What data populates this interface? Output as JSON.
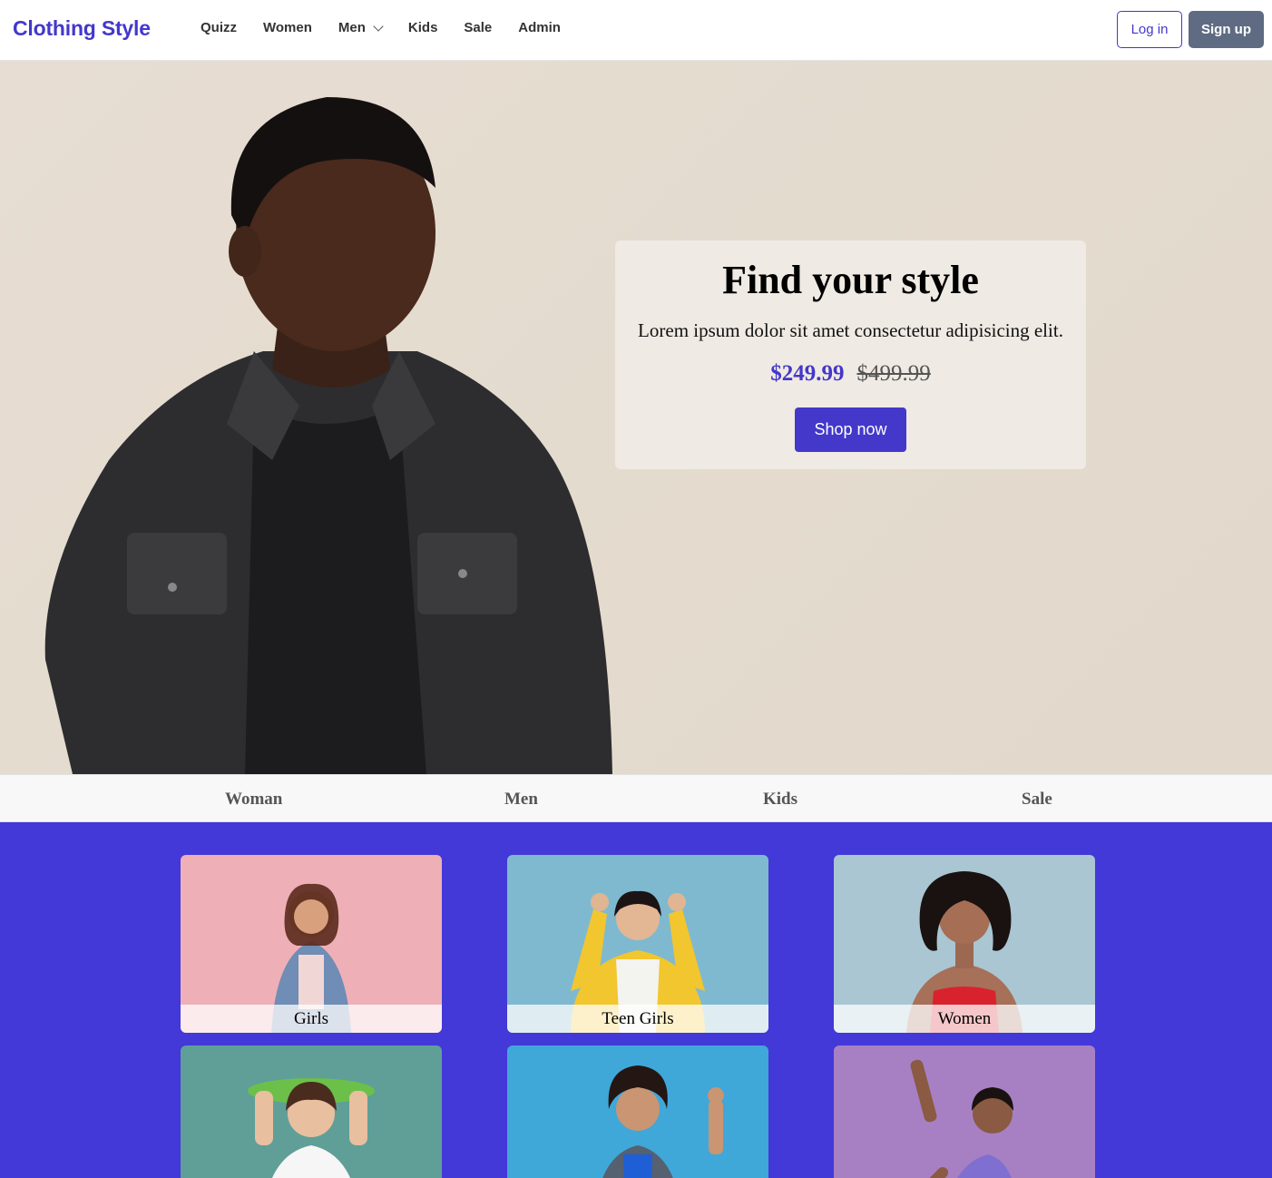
{
  "brand": "Clothing Style",
  "nav": {
    "links": [
      "Quizz",
      "Women",
      "Men",
      "Kids",
      "Sale",
      "Admin"
    ],
    "login": "Log in",
    "signup": "Sign up"
  },
  "hero": {
    "title": "Find your style",
    "subtitle": "Lorem ipsum dolor sit amet consectetur adipisicing elit.",
    "price_new": "$249.99",
    "price_old": "$499.99",
    "cta": "Shop now"
  },
  "categories": [
    "Woman",
    "Men",
    "Kids",
    "Sale"
  ],
  "tiles": [
    {
      "label": "Girls",
      "bg": "#eeb0b6"
    },
    {
      "label": "Teen Girls",
      "bg": "#7fb9d0"
    },
    {
      "label": "Women",
      "bg": "#a9c6d2"
    },
    {
      "label": "",
      "bg": "#5f9f98"
    },
    {
      "label": "",
      "bg": "#40a7d9"
    },
    {
      "label": "",
      "bg": "#a780c4"
    }
  ],
  "colors": {
    "accent": "#4338ca",
    "grid_bg": "#4338d8"
  }
}
